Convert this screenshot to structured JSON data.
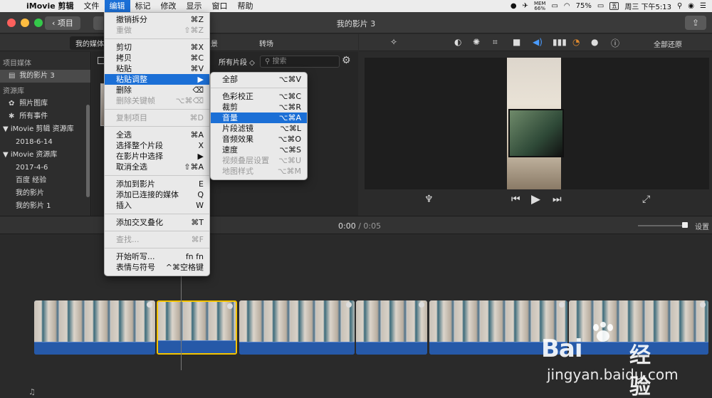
{
  "menubar": {
    "app": "iMovie 剪辑",
    "items": [
      "文件",
      "编辑",
      "标记",
      "修改",
      "显示",
      "窗口",
      "帮助"
    ],
    "mem_top": "MEM",
    "mem_value": "66%",
    "battery": "75%",
    "input_method": "五",
    "clock": "周三 下午5:13"
  },
  "window": {
    "back_label": "项目",
    "title": "我的影片 3"
  },
  "browser_tabs": [
    "我的媒体",
    "景",
    "转场"
  ],
  "sidebar": {
    "project_header": "项目媒体",
    "project_item": "我的影片 3",
    "library_header": "资源库",
    "items": [
      "照片图库",
      "所有事件"
    ],
    "lib1": "iMovie 剪辑 资源库",
    "lib1_events": [
      "2018-6-14"
    ],
    "lib2": "iMovie 资源库",
    "lib2_events": [
      "2017-4-6",
      "百度 经验",
      "我的影片",
      "我的影片 1"
    ]
  },
  "browser": {
    "filter": "所有片段 ◇",
    "search_placeholder": "搜索"
  },
  "viewer": {
    "reset_label": "全部还原"
  },
  "timeline": {
    "current": "0:00",
    "separator": "/",
    "total": "0:05",
    "settings": "设置"
  },
  "edit_menu": {
    "rows": [
      {
        "label": "撤销拆分",
        "sc": "⌘Z",
        "dis": false
      },
      {
        "label": "重做",
        "sc": "⇧⌘Z",
        "dis": true
      },
      {
        "sep": true
      },
      {
        "label": "剪切",
        "sc": "⌘X",
        "dis": false
      },
      {
        "label": "拷贝",
        "sc": "⌘C",
        "dis": false
      },
      {
        "label": "粘贴",
        "sc": "⌘V",
        "dis": false
      },
      {
        "label": "粘贴调整",
        "sc": "▶",
        "dis": false,
        "hl": true
      },
      {
        "label": "删除",
        "sc": "⌫",
        "dis": false
      },
      {
        "label": "删除关键帧",
        "sc": "⌥⌘⌫",
        "dis": true
      },
      {
        "sep": true
      },
      {
        "label": "复制项目",
        "sc": "⌘D",
        "dis": true
      },
      {
        "sep": true
      },
      {
        "label": "全选",
        "sc": "⌘A",
        "dis": false
      },
      {
        "label": "选择整个片段",
        "sc": "X",
        "dis": false
      },
      {
        "label": "在影片中选择",
        "sc": "▶",
        "dis": false
      },
      {
        "label": "取消全选",
        "sc": "⇧⌘A",
        "dis": false
      },
      {
        "sep": true
      },
      {
        "label": "添加到影片",
        "sc": "E",
        "dis": false
      },
      {
        "label": "添加已连接的媒体",
        "sc": "Q",
        "dis": false
      },
      {
        "label": "插入",
        "sc": "W",
        "dis": false
      },
      {
        "sep": true
      },
      {
        "label": "添加交叉叠化",
        "sc": "⌘T",
        "dis": false
      },
      {
        "sep": true
      },
      {
        "label": "查找...",
        "sc": "⌘F",
        "dis": true
      },
      {
        "sep": true
      },
      {
        "label": "开始听写...",
        "sc": "fn fn",
        "dis": false
      },
      {
        "label": "表情与符号",
        "sc": "^⌘空格键",
        "dis": false
      }
    ]
  },
  "paste_submenu": {
    "rows": [
      {
        "label": "全部",
        "sc": "⌥⌘V",
        "dis": false
      },
      {
        "sep": true
      },
      {
        "label": "色彩校正",
        "sc": "⌥⌘C",
        "dis": false
      },
      {
        "label": "裁剪",
        "sc": "⌥⌘R",
        "dis": false
      },
      {
        "label": "音量",
        "sc": "⌥⌘A",
        "dis": false,
        "hl": true
      },
      {
        "label": "片段滤镜",
        "sc": "⌥⌘L",
        "dis": false
      },
      {
        "label": "音频效果",
        "sc": "⌥⌘O",
        "dis": false
      },
      {
        "label": "速度",
        "sc": "⌥⌘S",
        "dis": false
      },
      {
        "label": "视频叠层设置",
        "sc": "⌥⌘U",
        "dis": true
      },
      {
        "label": "地图样式",
        "sc": "⌥⌘M",
        "dis": true
      }
    ]
  },
  "watermark": {
    "brand_left": "Bai",
    "brand_right": "经验",
    "url": "jingyan.baidu.com"
  }
}
